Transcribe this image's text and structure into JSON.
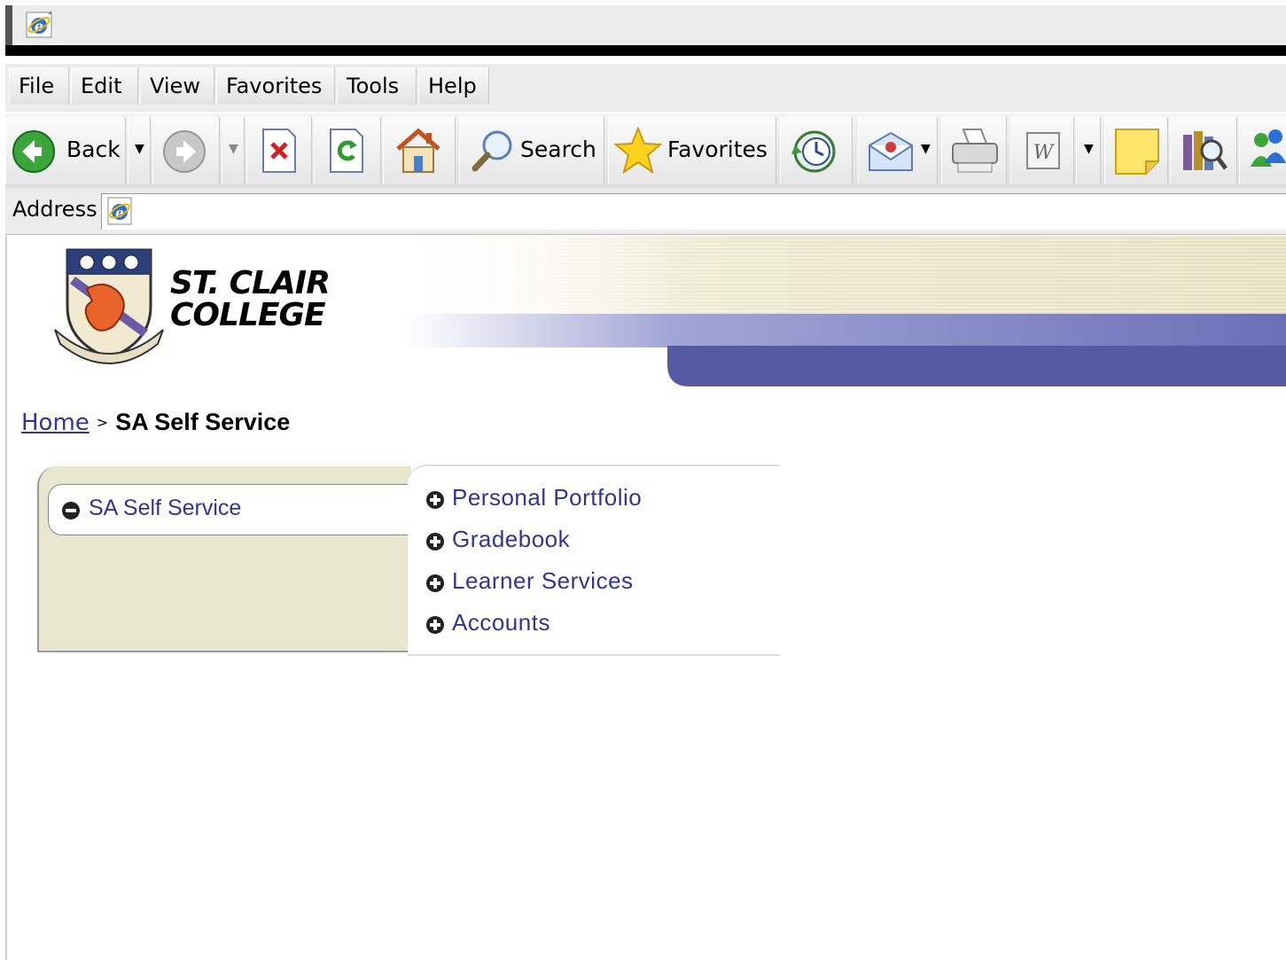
{
  "browser": {
    "menu": [
      "File",
      "Edit",
      "View",
      "Favorites",
      "Tools",
      "Help"
    ],
    "toolbar": {
      "back_label": "Back",
      "search_label": "Search",
      "favorites_label": "Favorites"
    },
    "address": {
      "label": "Address"
    }
  },
  "page": {
    "college_name_line1": "ST. CLAIR",
    "college_name_line2": "COLLEGE",
    "breadcrumb": {
      "home": "Home",
      "separator": ">",
      "current": "SA Self Service"
    },
    "menu": {
      "selected": "SA Self Service",
      "items": [
        "Personal Portfolio",
        "Gradebook",
        "Learner Services",
        "Accounts"
      ]
    }
  },
  "colors": {
    "link": "#333399",
    "panel": "#e8e6cc",
    "banner_purple": "#5a5ca8"
  }
}
